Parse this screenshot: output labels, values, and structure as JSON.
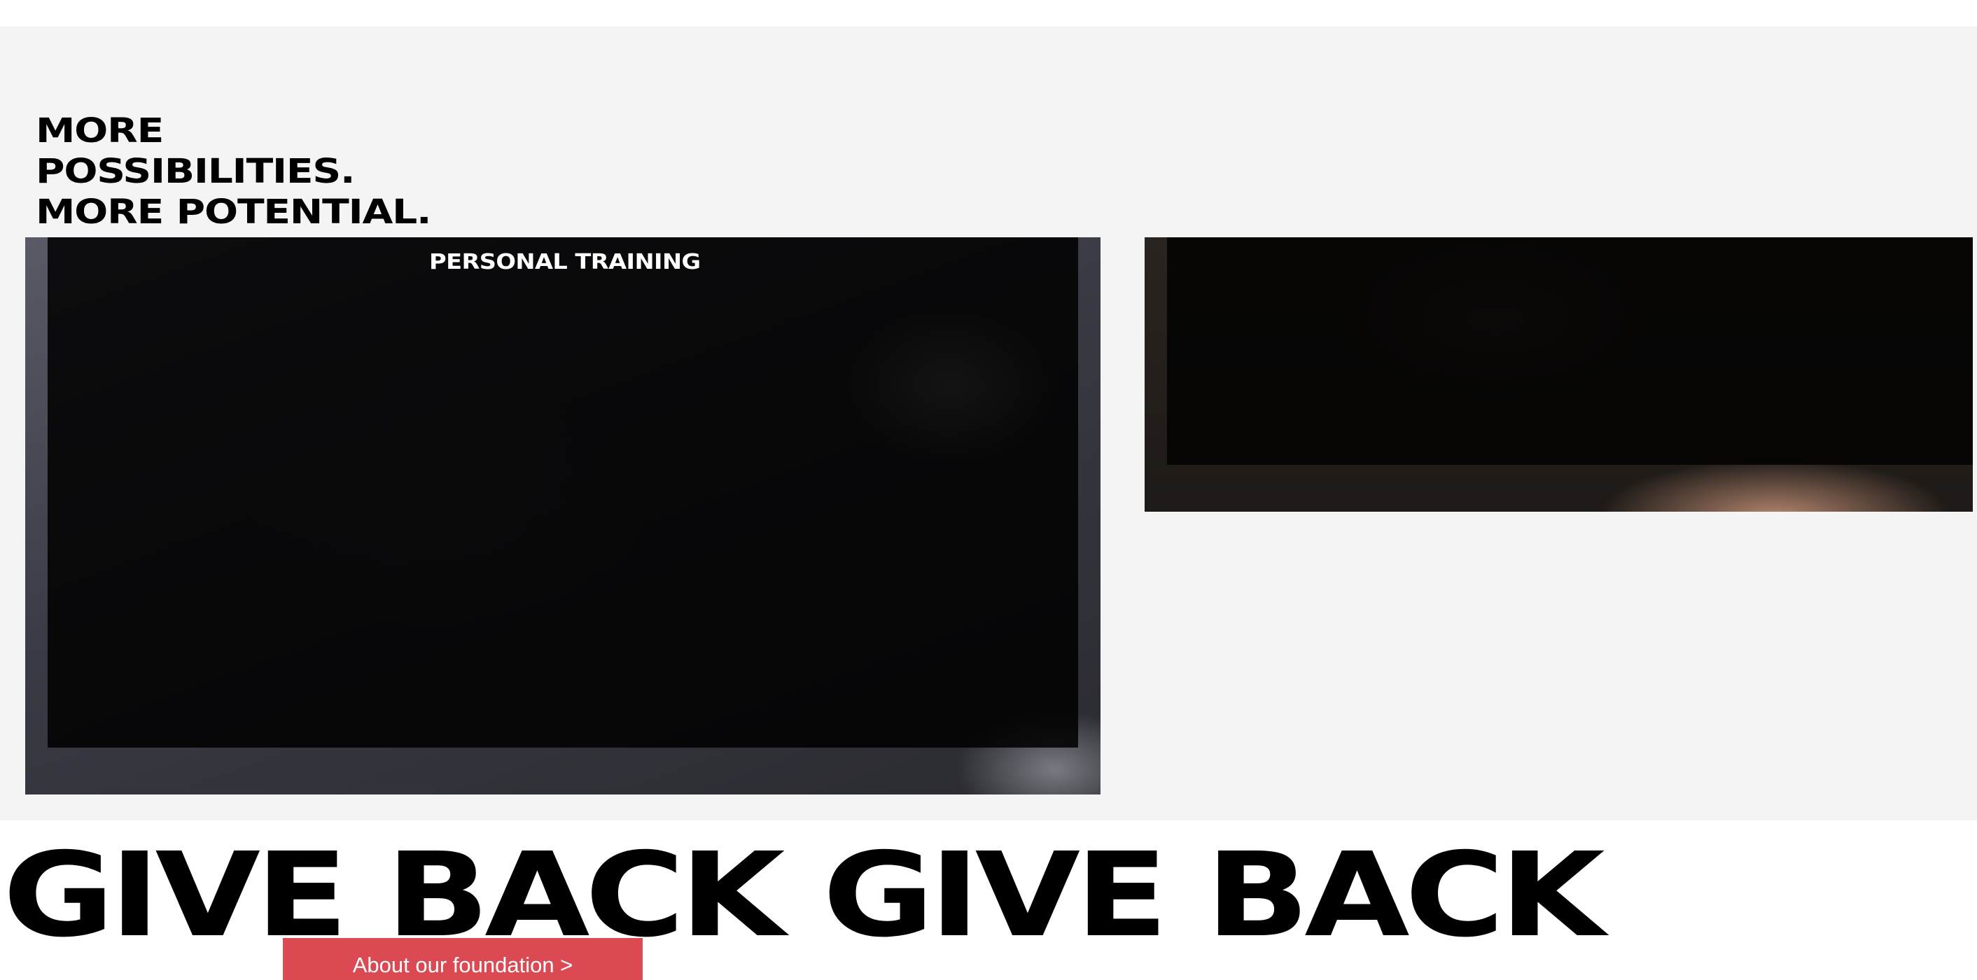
{
  "possibilities_section": {
    "headline_lines": [
      "MORE",
      "POSSIBILITIES.",
      "MORE POTENTIAL."
    ],
    "background_color": "#f4f4f4",
    "cards": [
      {
        "label": "PERSONAL TRAINING"
      },
      {
        "label": ""
      }
    ]
  },
  "give_back_section": {
    "banner_text": "GIVE BACK GIVE BACK",
    "foundation_button_label": "About our foundation >",
    "button_color": "#db4a52"
  }
}
